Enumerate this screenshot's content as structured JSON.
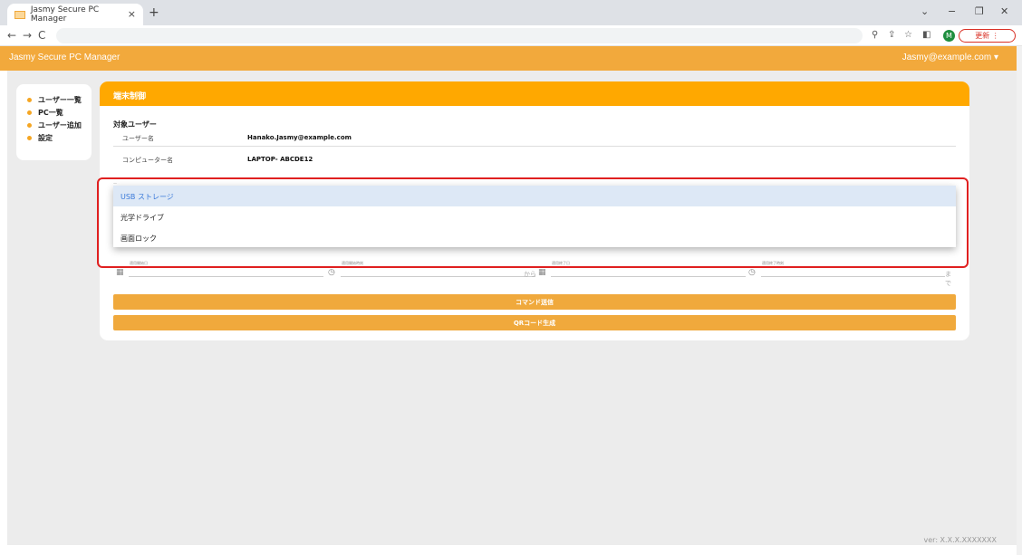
{
  "browser": {
    "tab_title": "Jasmy Secure PC Manager",
    "tab_close": "×",
    "new_tab": "+",
    "update_label": "更新 ⋮",
    "avatar_letter": "M",
    "win_min": "−",
    "win_max": "❐",
    "win_close": "✕",
    "win_down": "⌄"
  },
  "app": {
    "title": "Jasmy Secure PC Manager",
    "user": "Jasmy@example.com ▾",
    "version": "ver: X.X.X.XXXXXXX"
  },
  "sidebar": {
    "items": [
      {
        "label": "ユーザー一覧"
      },
      {
        "label": "PC一覧"
      },
      {
        "label": "ユーザー追加"
      },
      {
        "label": "設定"
      }
    ]
  },
  "card": {
    "header": "端末制御",
    "section": "対象ユーザー",
    "rows": [
      {
        "label": "ユーザー名",
        "value": "Hanako.Jasmy@example.com"
      },
      {
        "label": "コンピューター名",
        "value": "LAPTOP- ABCDE12"
      }
    ]
  },
  "dropdown": {
    "options": [
      {
        "label": "USB ストレージ",
        "selected": true
      },
      {
        "label": "光学ドライブ",
        "selected": false
      },
      {
        "label": "画面ロック",
        "selected": false
      }
    ]
  },
  "dates": {
    "start_date_label": "適用開始日",
    "start_time_label": "適用開始時刻",
    "end_date_label": "適用終了日",
    "end_time_label": "適用終了時刻",
    "kara": "から",
    "made": "まで"
  },
  "buttons": {
    "command": "コマンド送信",
    "qr": "QRコード生成"
  },
  "colors": {
    "brand": "#f2a93c",
    "card_header": "#ffa800",
    "highlight": "#e02020",
    "selected_bg": "#dde8f6"
  }
}
